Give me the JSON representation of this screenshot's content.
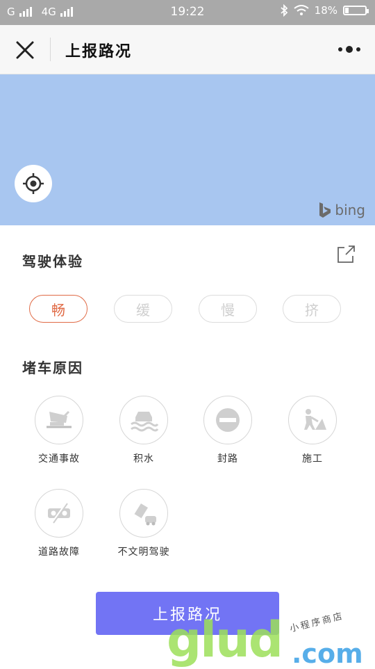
{
  "status_bar": {
    "carrier1": "G",
    "carrier2": "4G",
    "time": "19:22",
    "battery_text": "18%",
    "battery_level": 0.18
  },
  "nav": {
    "title": "上报路况"
  },
  "map": {
    "attribution": "bing"
  },
  "driving": {
    "title": "驾驶体验",
    "options": [
      "畅",
      "缓",
      "慢",
      "挤"
    ],
    "selected": 0,
    "accent": "#e06a45"
  },
  "reasons": {
    "title": "堵车原因",
    "items": [
      {
        "label": "交通事故",
        "icon": "car-accident-icon"
      },
      {
        "label": "积水",
        "icon": "flooding-icon"
      },
      {
        "label": "封路",
        "icon": "road-closed-icon"
      },
      {
        "label": "施工",
        "icon": "construction-icon"
      },
      {
        "label": "道路故障",
        "icon": "road-fault-icon"
      },
      {
        "label": "不文明驾驶",
        "icon": "reckless-driving-icon"
      }
    ]
  },
  "submit": {
    "label": "上报路况",
    "color": "#7274f4"
  },
  "watermark": {
    "big": "glud",
    "com": ".com",
    "small": "小程序商店"
  }
}
